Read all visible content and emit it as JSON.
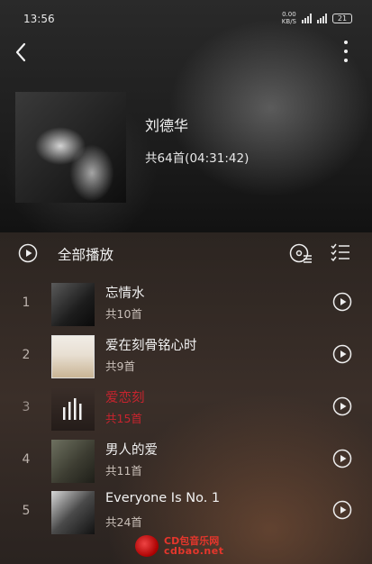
{
  "status_bar": {
    "time": "13:56",
    "net_speed_value": "0.00",
    "net_speed_unit": "KB/S",
    "battery": "21"
  },
  "artist": {
    "name": "刘德华",
    "summary": "共64首(04:31:42)"
  },
  "toolbar": {
    "play_all_label": "全部播放"
  },
  "albums": [
    {
      "index": "1",
      "title": "忘情水",
      "count": "共10首"
    },
    {
      "index": "2",
      "title": "爱在刻骨铭心时",
      "count": "共9首"
    },
    {
      "index": "3",
      "title": "爱恋刻",
      "count": "共15首"
    },
    {
      "index": "4",
      "title": "男人的爱",
      "count": "共11首"
    },
    {
      "index": "5",
      "title": "Everyone Is No. 1",
      "count": "共24首"
    }
  ],
  "now_playing_index": 3,
  "colors": {
    "accent_playing": "#c8242e",
    "text_primary": "#f2f2f2",
    "text_secondary": "#c9bfb8"
  },
  "watermark": {
    "cn": "CD包音乐网",
    "en": "cdbao.net"
  }
}
